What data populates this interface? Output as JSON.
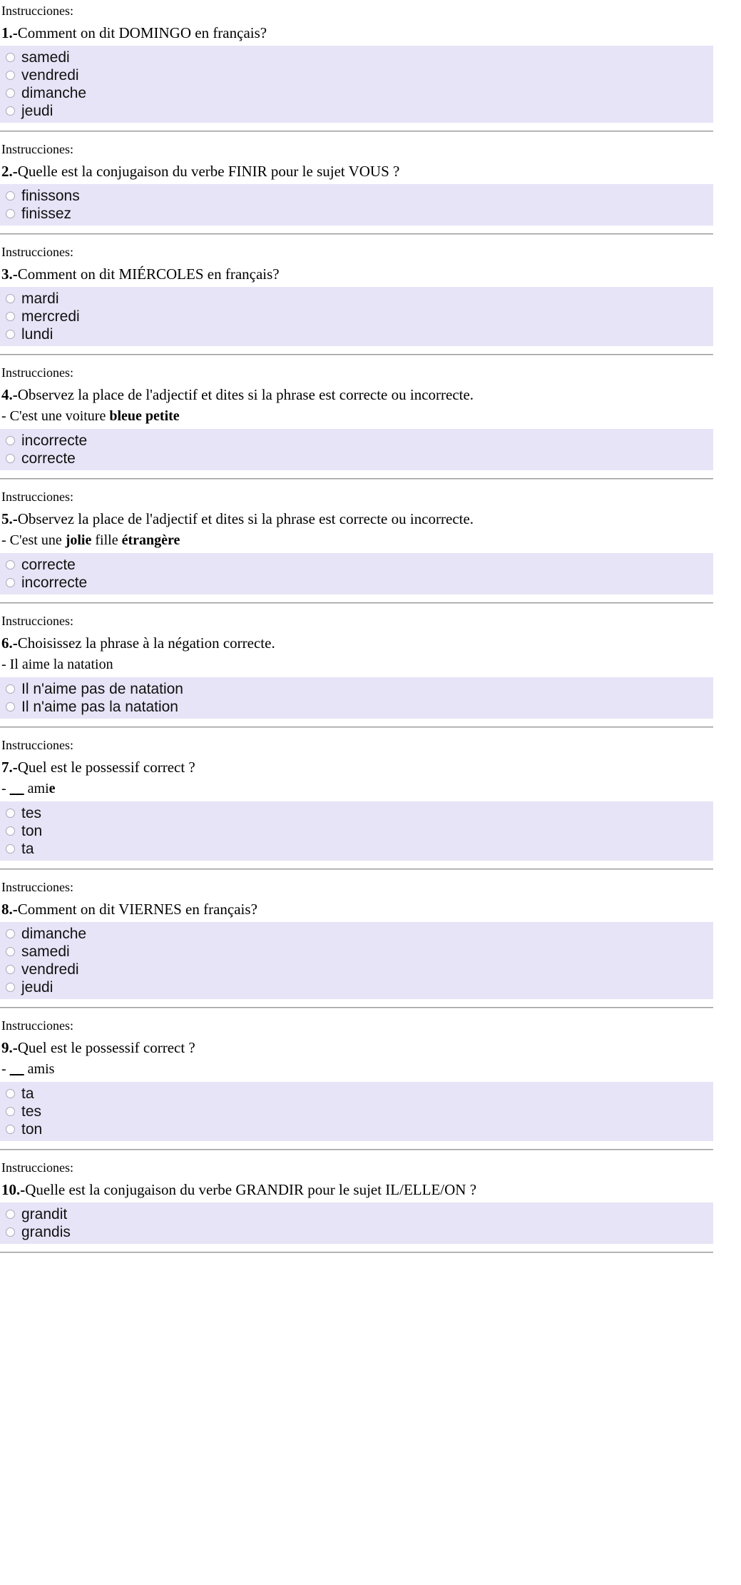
{
  "document": {
    "instructions_label": "Instrucciones:",
    "radio_icon": "radio-unchecked-icon",
    "colors": {
      "option_block_bg": "#e6e4f6",
      "page_bg": "#ffffff",
      "text": "#000000",
      "divider": "#9b9b9b"
    }
  },
  "questions": [
    {
      "instructions": "Instrucciones:",
      "number": "1.-",
      "stem": "Comment on dit DOMINGO en français?",
      "sub": "",
      "options": [
        "samedi",
        "vendredi",
        "dimanche",
        "jeudi"
      ]
    },
    {
      "instructions": "Instrucciones:",
      "number": "2.-",
      "stem": "Quelle est la conjugaison du verbe FINIR pour le sujet VOUS ?",
      "sub": "",
      "options": [
        "finissons",
        "finissez"
      ]
    },
    {
      "instructions": "Instrucciones:",
      "number": "3.-",
      "stem": "Comment on dit MIÉRCOLES en français?",
      "sub": "",
      "options": [
        "mardi",
        "mercredi",
        "lundi"
      ]
    },
    {
      "instructions": "Instrucciones:",
      "number": "4.-",
      "stem": "Observez la place de l'adjectif et dites si la phrase est correcte ou incorrecte.",
      "sub": "- C'est une voiture bleue petite",
      "sub_bold": "bleue petite",
      "options": [
        "incorrecte",
        "correcte"
      ]
    },
    {
      "instructions": "Instrucciones:",
      "number": "5.-",
      "stem": "Observez la place de l'adjectif et dites si la phrase est correcte ou incorrecte.",
      "sub": "- C'est une jolie fille étrangère",
      "sub_bold": "jolie / étrangère",
      "options": [
        "correcte",
        "incorrecte"
      ]
    },
    {
      "instructions": "Instrucciones:",
      "number": "6.-",
      "stem": "Choisissez la phrase à la négation correcte.",
      "sub": "- Il aime la natation",
      "options": [
        "Il n'aime pas de natation",
        "Il n'aime pas la natation"
      ]
    },
    {
      "instructions": "Instrucciones:",
      "number": "7.-",
      "stem": "Quel est le possessif correct ?",
      "sub": "- ____ amie",
      "sub_bold": "e",
      "options": [
        "tes",
        "ton",
        "ta"
      ]
    },
    {
      "instructions": "Instrucciones:",
      "number": "8.-",
      "stem": "Comment on dit VIERNES en français?",
      "sub": "",
      "options": [
        "dimanche",
        "samedi",
        "vendredi",
        "jeudi"
      ]
    },
    {
      "instructions": "Instrucciones:",
      "number": "9.-",
      "stem": "Quel est le possessif correct ?",
      "sub": "- ____ amis",
      "options": [
        "ta",
        "tes",
        "ton"
      ]
    },
    {
      "instructions": "Instrucciones:",
      "number": "10.-",
      "stem": "Quelle est la conjugaison du verbe GRANDIR pour le sujet IL/ELLE/ON ?",
      "sub": "",
      "options": [
        "grandit",
        "grandis"
      ]
    }
  ]
}
